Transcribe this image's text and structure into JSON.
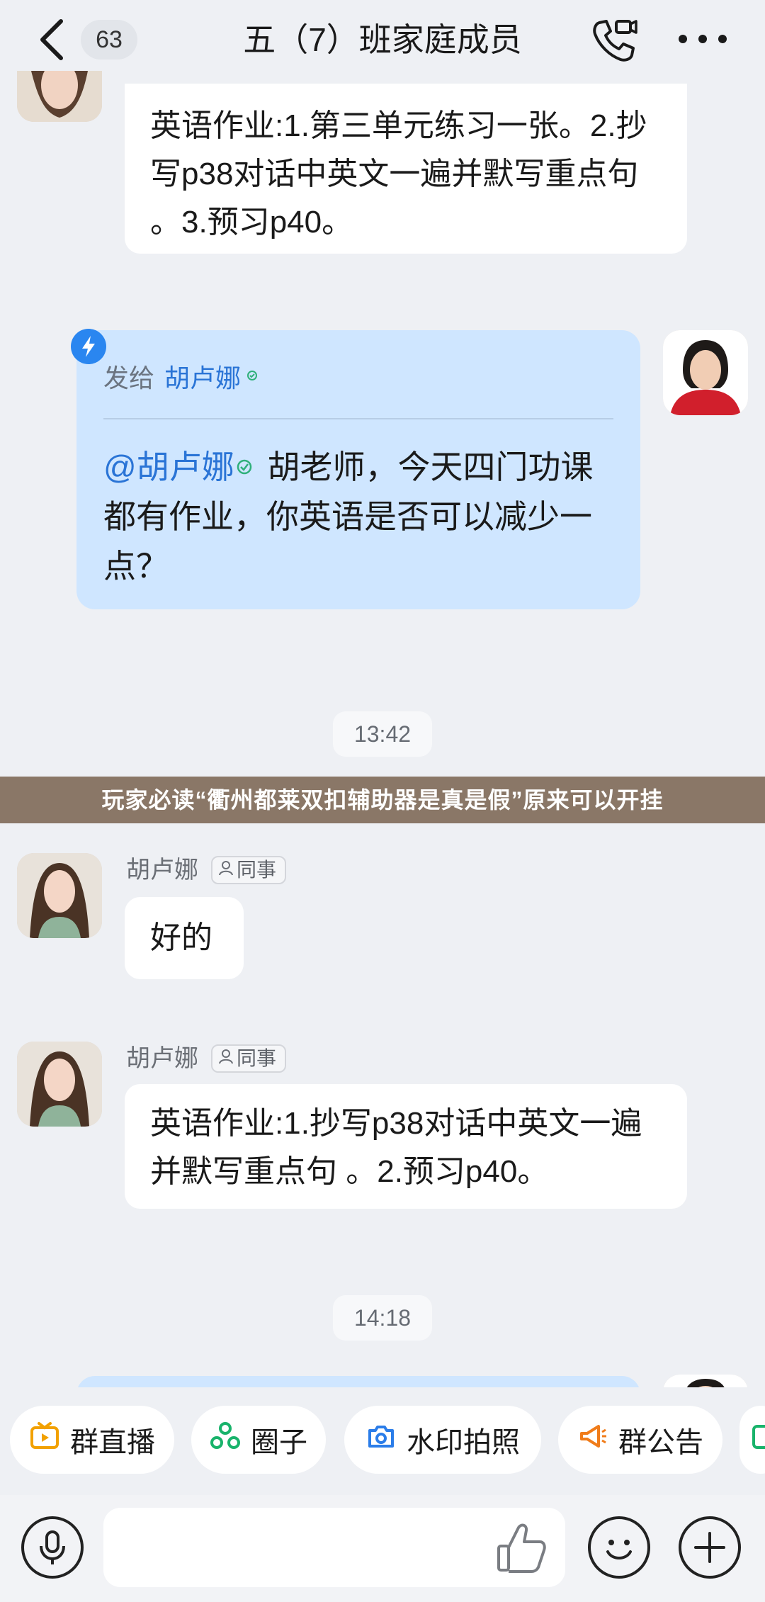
{
  "header": {
    "unread_count": "63",
    "title": "五（7）班家庭成员"
  },
  "messages": {
    "first_partial": {
      "text": "英语作业:1.第三单元练习一张。2.抄写p38对话中英文一遍并默写重点句 。3.预习p40。"
    },
    "reply_bubble": {
      "send_to_label": "发给",
      "send_to_name": "胡卢娜",
      "mention": "@胡卢娜",
      "body": "胡老师，今天四门功课都有作业，你英语是否可以减少一点？"
    },
    "time_1": "13:42",
    "msg_ok": {
      "sender": "胡卢娜",
      "tag": "同事",
      "text": "好的"
    },
    "msg_homework": {
      "sender": "胡卢娜",
      "tag": "同事",
      "text": "英语作业:1.抄写p38对话中英文一遍并默写重点句 。2.预习p40。"
    },
    "time_2": "14:18"
  },
  "overlay_banner": {
    "text": "玩家必读“衢州都莱双扣辅助器是真是假”原来可以开挂"
  },
  "quick_actions": [
    {
      "label": "群直播",
      "icon": "live-tv-icon",
      "color": "#f2a100"
    },
    {
      "label": "圈子",
      "icon": "circle-group-icon",
      "color": "#19b36b"
    },
    {
      "label": "水印拍照",
      "icon": "camera-icon",
      "color": "#2b7de9"
    },
    {
      "label": "群公告",
      "icon": "megaphone-icon",
      "color": "#f07c1a"
    }
  ],
  "input": {
    "placeholder": ""
  },
  "colors": {
    "background": "#eef0f4",
    "bubble_blue": "#cfe6ff",
    "mention_blue": "#2a74d6",
    "banner": "#8a7767"
  }
}
